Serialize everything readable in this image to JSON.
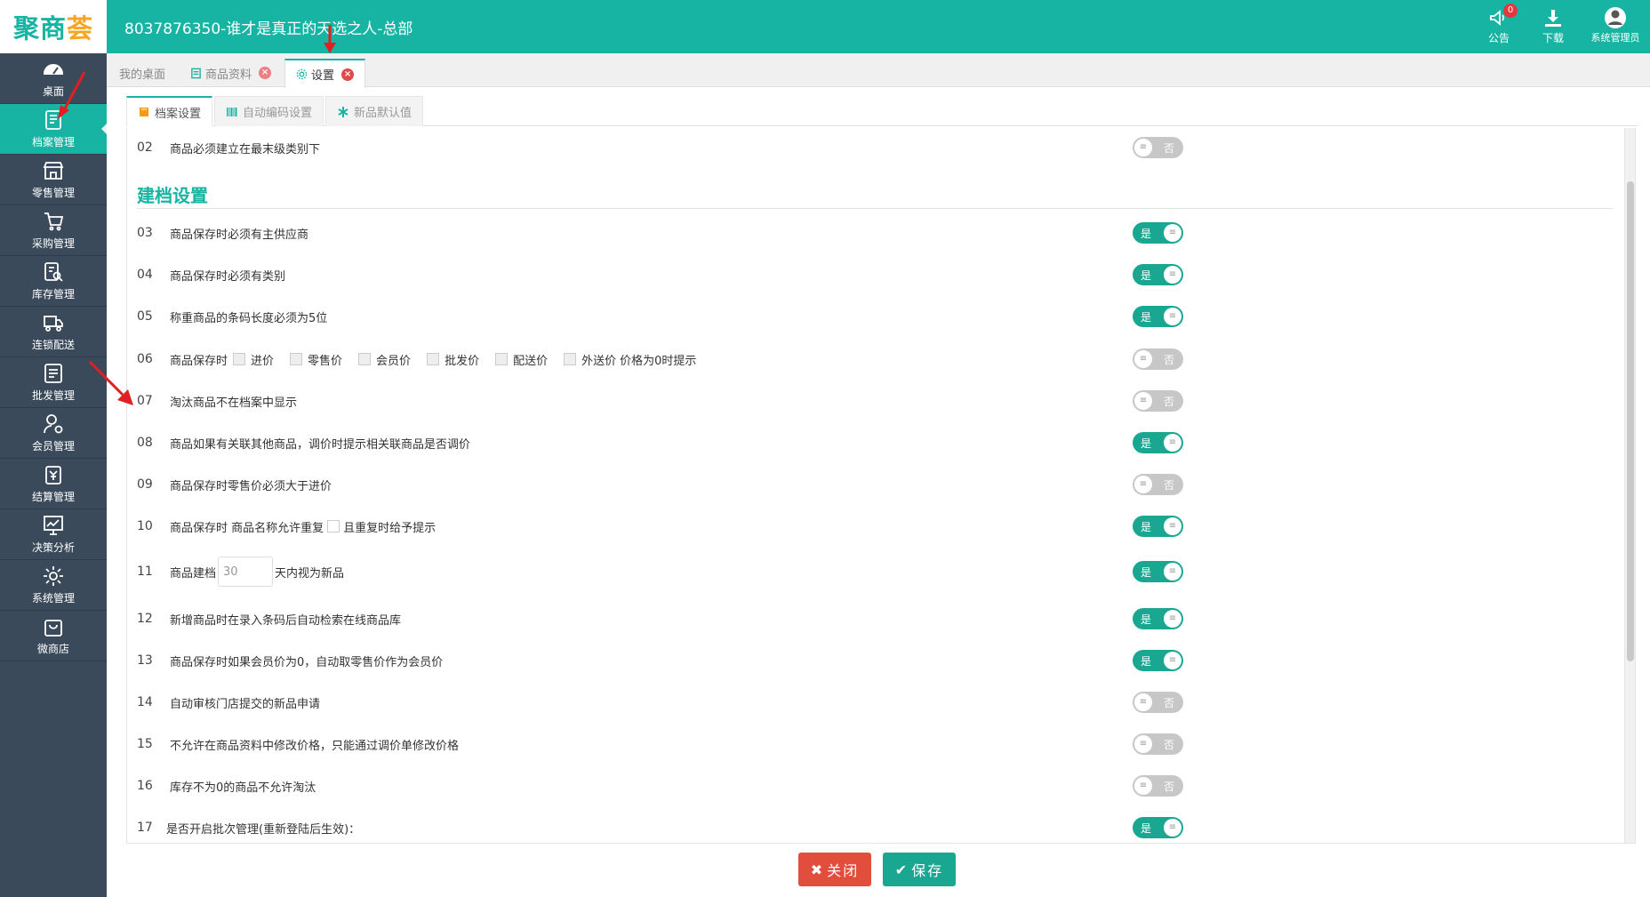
{
  "app": {
    "logo_a": "聚商",
    "logo_b": "荟",
    "title": "8037876350-谁才是真正的天选之人-总部"
  },
  "header": {
    "notice_label": "公告",
    "notice_count": "0",
    "download_label": "下载",
    "user_label": "系统管理员"
  },
  "sidebar": {
    "items": [
      {
        "label": "桌面",
        "icon": "dashboard-icon"
      },
      {
        "label": "档案管理",
        "icon": "archive-icon"
      },
      {
        "label": "零售管理",
        "icon": "store-icon"
      },
      {
        "label": "采购管理",
        "icon": "cart-icon"
      },
      {
        "label": "库存管理",
        "icon": "inventory-icon"
      },
      {
        "label": "连锁配送",
        "icon": "truck-icon"
      },
      {
        "label": "批发管理",
        "icon": "wholesale-icon"
      },
      {
        "label": "会员管理",
        "icon": "member-icon"
      },
      {
        "label": "结算管理",
        "icon": "yen-icon"
      },
      {
        "label": "决策分析",
        "icon": "chart-icon"
      },
      {
        "label": "系统管理",
        "icon": "gear-icon"
      },
      {
        "label": "微商店",
        "icon": "shop-bag-icon"
      }
    ],
    "active": "档案管理"
  },
  "tabs": {
    "desktop": "我的桌面",
    "goods": "商品资料",
    "settings": "设置"
  },
  "subtabs": {
    "archive": "档案设置",
    "autocode": "自动编码设置",
    "newdefault": "新品默认值"
  },
  "section": {
    "title": "建档设置"
  },
  "toggle_labels": {
    "on": "是",
    "off": "否",
    "knob": "≡"
  },
  "rows": {
    "r02": {
      "num": "02",
      "text": "商品必须建立在最末级类别下",
      "on": false
    },
    "r03": {
      "num": "03",
      "text": "商品保存时必须有主供应商",
      "on": true
    },
    "r04": {
      "num": "04",
      "text": "商品保存时必须有类别",
      "on": true
    },
    "r05": {
      "num": "05",
      "text": "称重商品的条码长度必须为5位",
      "on": true
    },
    "r06": {
      "num": "06",
      "prefix": "商品保存时",
      "opts": [
        "进价",
        "零售价",
        "会员价",
        "批发价",
        "配送价",
        "外送价"
      ],
      "suffix": "价格为0时提示",
      "on": false
    },
    "r07": {
      "num": "07",
      "text": "淘汰商品不在档案中显示",
      "on": false
    },
    "r08": {
      "num": "08",
      "text": "商品如果有关联其他商品，调价时提示相关联商品是否调价",
      "on": true
    },
    "r09": {
      "num": "09",
      "text": "商品保存时零售价必须大于进价",
      "on": false
    },
    "r10": {
      "num": "10",
      "prefix": "商品保存时 商品名称允许重复",
      "suffix": "且重复时给予提示",
      "on": true
    },
    "r11": {
      "num": "11",
      "prefix": "商品建档",
      "days": "30",
      "suffix": "天内视为新品",
      "on": true
    },
    "r12": {
      "num": "12",
      "text": "新增商品时在录入条码后自动检索在线商品库",
      "on": true
    },
    "r13": {
      "num": "13",
      "text": "商品保存时如果会员价为0，自动取零售价作为会员价",
      "on": true
    },
    "r14": {
      "num": "14",
      "text": "自动审核门店提交的新品申请",
      "on": false
    },
    "r15": {
      "num": "15",
      "text": "不允许在商品资料中修改价格，只能通过调价单修改价格",
      "on": false
    },
    "r16": {
      "num": "16",
      "text": "库存不为0的商品不允许淘汰",
      "on": false
    },
    "r17": {
      "num": "17",
      "text": "是否开启批次管理(重新登陆后生效)：",
      "on": true
    }
  },
  "buttons": {
    "close_icon": "✖",
    "close": "关闭",
    "save_icon": "✔",
    "save": "保存"
  },
  "colors": {
    "brand": "#17b3a3",
    "sidebar": "#3a4a5b",
    "toggle_on": "#1aa791",
    "toggle_off": "#c7c7c7",
    "close": "#e24e3c"
  }
}
